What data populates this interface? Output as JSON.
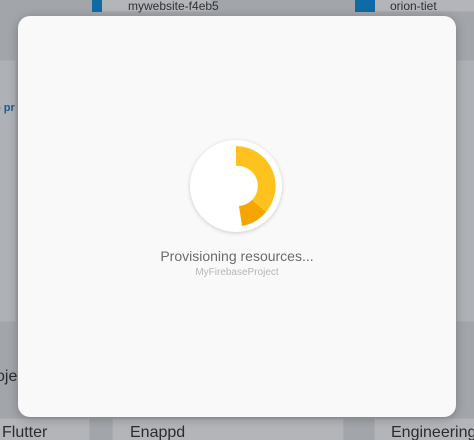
{
  "background": {
    "card_top_left_label": "mywebsite-f4eb5",
    "card_top_right_label": "orion-tiet",
    "left_link_fragment": "p pr",
    "section_fragment": "oje",
    "card_bottom_left_label": "Flutter",
    "card_bottom_mid_label": "Enappd",
    "card_bottom_right_label": "Engineering",
    "accent_color": "#0f6aa6"
  },
  "modal": {
    "status_text": "Provisioning resources...",
    "project_name": "MyFirebaseProject",
    "spinner_icon": "progress-ring-icon",
    "spinner_colors": [
      "#fec21f",
      "#f5a500"
    ]
  }
}
